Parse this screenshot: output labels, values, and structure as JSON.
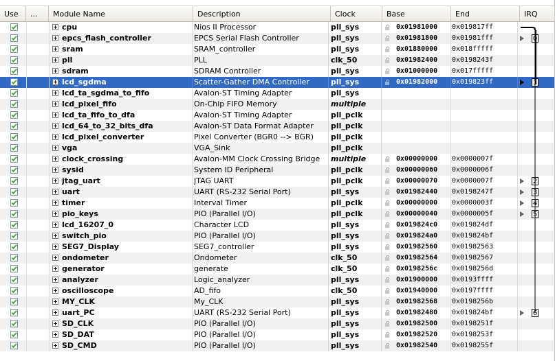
{
  "columns": {
    "use": "Use",
    "more": "...",
    "module_name": "Module Name",
    "description": "Description",
    "clock": "Clock",
    "base": "Base",
    "end": "End",
    "irq": "IRQ"
  },
  "rows": [
    {
      "name": "cpu",
      "desc": "Nios II Processor",
      "clock": "pll_sys",
      "base": "0x01981000",
      "end": "0x019817ff"
    },
    {
      "name": "epcs_flash_controller",
      "desc": "EPCS Serial Flash Controller",
      "clock": "pll_sys",
      "base": "0x01981800",
      "end": "0x01981fff",
      "irq": "0"
    },
    {
      "name": "sram",
      "desc": "SRAM_controller",
      "clock": "pll_sys",
      "base": "0x01880000",
      "end": "0x018fffff"
    },
    {
      "name": "pll",
      "desc": "PLL",
      "clock": "clk_50",
      "base": "0x01982400",
      "end": "0x0198243f"
    },
    {
      "name": "sdram",
      "desc": "SDRAM Controller",
      "clock": "pll_sys",
      "base": "0x01000000",
      "end": "0x017fffff"
    },
    {
      "name": "lcd_sgdma",
      "desc": "Scatter-Gather DMA Controller",
      "clock": "pll_sys",
      "base": "0x01982000",
      "end": "0x019823ff",
      "irq": "1",
      "selected": true
    },
    {
      "name": "lcd_ta_sgdma_to_fifo",
      "desc": "Avalon-ST Timing Adapter",
      "clock": "pll_sys",
      "base": "",
      "end": ""
    },
    {
      "name": "lcd_pixel_fifo",
      "desc": "On-Chip FIFO Memory",
      "clock": "multiple",
      "base": "",
      "end": ""
    },
    {
      "name": "lcd_ta_fifo_to_dfa",
      "desc": "Avalon-ST Timing Adapter",
      "clock": "pll_pclk",
      "base": "",
      "end": ""
    },
    {
      "name": "lcd_64_to_32_bits_dfa",
      "desc": "Avalon-ST Data Format Adapter",
      "clock": "pll_pclk",
      "base": "",
      "end": ""
    },
    {
      "name": "lcd_pixel_converter",
      "desc": "Pixel Converter (BGR0 --> BGR)",
      "clock": "pll_pclk",
      "base": "",
      "end": ""
    },
    {
      "name": "vga",
      "desc": "VGA_Sink",
      "clock": "pll_pclk",
      "base": "",
      "end": ""
    },
    {
      "name": "clock_crossing",
      "desc": "Avalon-MM Clock Crossing Bridge",
      "clock": "multiple",
      "base": "0x00000000",
      "end": "0x0000007f"
    },
    {
      "name": "sysid",
      "desc": "System ID Peripheral",
      "clock": "pll_pclk",
      "base": "0x00000060",
      "end": "0x0000006f"
    },
    {
      "name": "jtag_uart",
      "desc": "JTAG UART",
      "clock": "pll_pclk",
      "base": "0x00000070",
      "end": "0x0000007f",
      "irq": "2"
    },
    {
      "name": "uart",
      "desc": "UART (RS-232 Serial Port)",
      "clock": "pll_sys",
      "base": "0x01982440",
      "end": "0x0198247f",
      "irq": "3"
    },
    {
      "name": "timer",
      "desc": "Interval Timer",
      "clock": "pll_pclk",
      "base": "0x00000000",
      "end": "0x0000003f",
      "irq": "4"
    },
    {
      "name": "pio_keys",
      "desc": "PIO (Parallel I/O)",
      "clock": "pll_pclk",
      "base": "0x00000040",
      "end": "0x0000005f",
      "irq": "5"
    },
    {
      "name": "lcd_16207_0",
      "desc": "Character LCD",
      "clock": "pll_sys",
      "base": "0x019824c0",
      "end": "0x019824df"
    },
    {
      "name": "switch_pio",
      "desc": "PIO (Parallel I/O)",
      "clock": "pll_sys",
      "base": "0x019824a0",
      "end": "0x019824bf"
    },
    {
      "name": "SEG7_Display",
      "desc": "SEG7_controller",
      "clock": "pll_sys",
      "base": "0x01982560",
      "end": "0x01982563"
    },
    {
      "name": "ondometer",
      "desc": "Ondometer",
      "clock": "clk_50",
      "base": "0x01982564",
      "end": "0x01982567"
    },
    {
      "name": "generator",
      "desc": "generate",
      "clock": "clk_50",
      "base": "0x0198256c",
      "end": "0x0198256d"
    },
    {
      "name": "analyzer",
      "desc": "Logic_analyzer",
      "clock": "pll_sys",
      "base": "0x01900000",
      "end": "0x0193ffff"
    },
    {
      "name": "oscilloscope",
      "desc": "AD_fifo",
      "clock": "clk_50",
      "base": "0x01940000",
      "end": "0x0197ffff"
    },
    {
      "name": "MY_CLK",
      "desc": "My_CLK",
      "clock": "pll_sys",
      "base": "0x01982568",
      "end": "0x0198256b"
    },
    {
      "name": "uart_PC",
      "desc": "UART (RS-232 Serial Port)",
      "clock": "pll_sys",
      "base": "0x01982480",
      "end": "0x019824bf",
      "irq": "6"
    },
    {
      "name": "SD_CLK",
      "desc": "PIO (Parallel I/O)",
      "clock": "pll_sys",
      "base": "0x01982500",
      "end": "0x0198251f"
    },
    {
      "name": "SD_DAT",
      "desc": "PIO (Parallel I/O)",
      "clock": "pll_sys",
      "base": "0x01982520",
      "end": "0x0198253f"
    },
    {
      "name": "SD_CMD",
      "desc": "PIO (Parallel I/O)",
      "clock": "pll_sys",
      "base": "0x01982540",
      "end": "0x0198255f"
    }
  ],
  "colors": {
    "selection": "#316ac5",
    "alt_row": "#f0f0f0",
    "check": "#21a121"
  }
}
